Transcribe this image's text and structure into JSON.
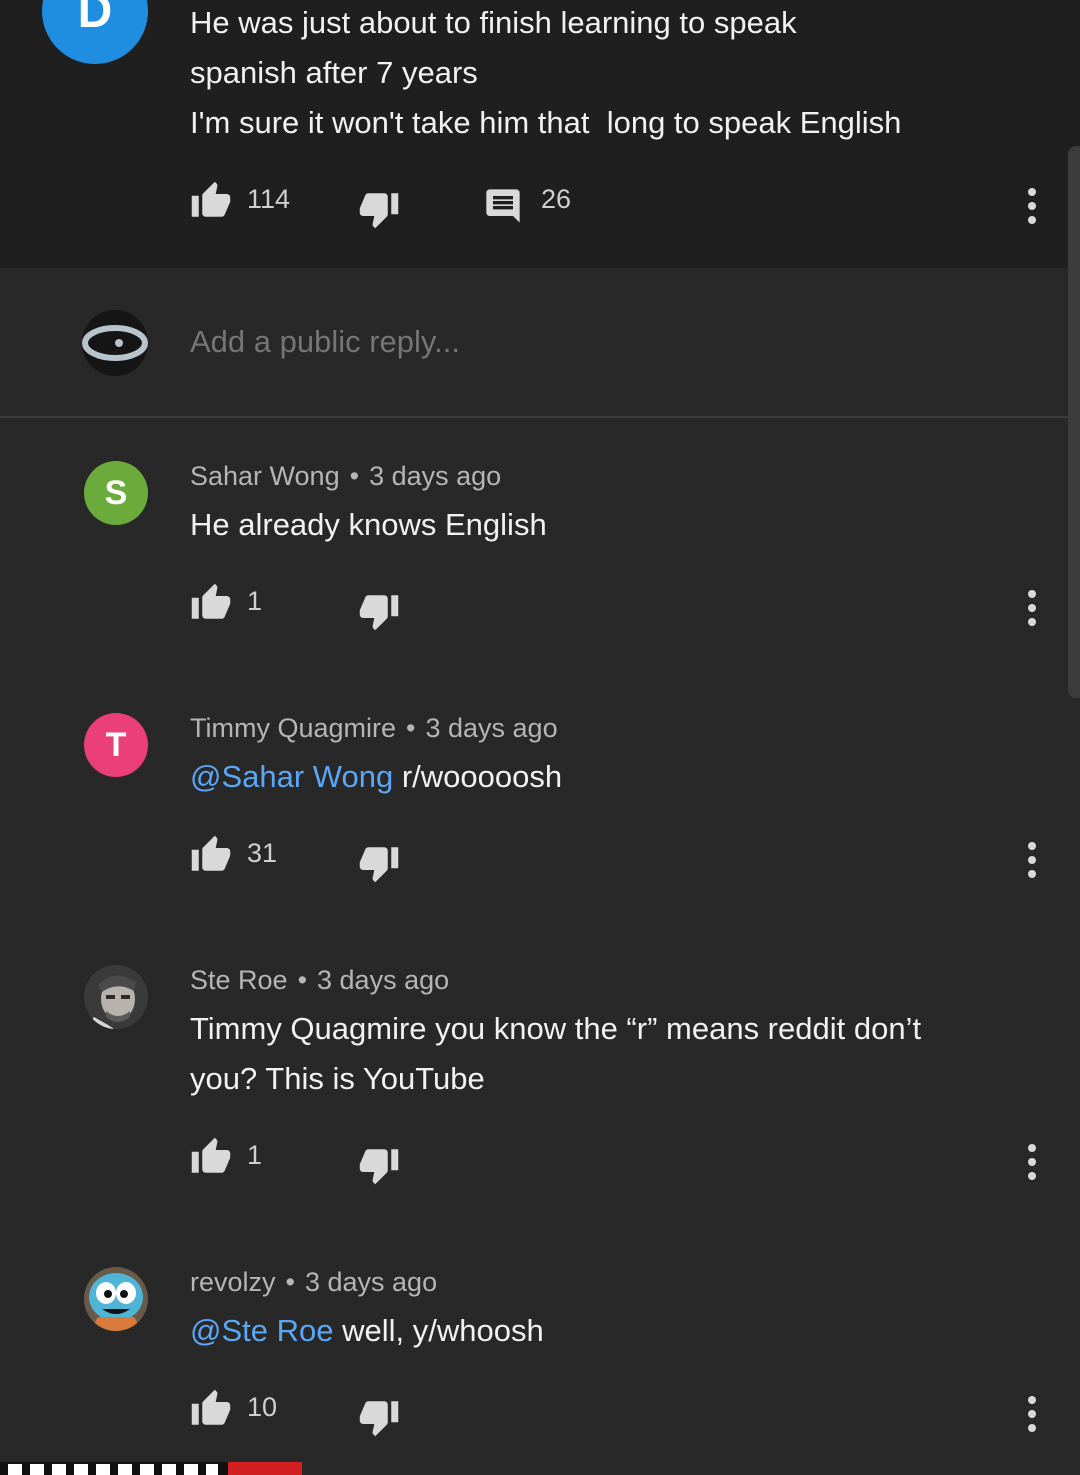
{
  "top_comment": {
    "avatar_letter": "D",
    "avatar_color": "#1f8ee0",
    "lines": [
      "He was just about to finish learning to speak",
      "spanish after 7 years",
      "I'm sure it won't take him that  long to speak English"
    ],
    "likes": "114",
    "replies_count": "26"
  },
  "reply_box": {
    "placeholder": "Add a public reply..."
  },
  "replies": [
    {
      "author": "Sahar Wong",
      "time": "3 days ago",
      "avatar_letter": "S",
      "avatar_color": "#6aab3b",
      "mention": "",
      "lines": [
        "He already knows English"
      ],
      "likes": "1"
    },
    {
      "author": "Timmy Quagmire",
      "time": "3 days ago",
      "avatar_letter": "T",
      "avatar_color": "#ea3f79",
      "mention": "@Sahar Wong",
      "lines": [
        " r/wooooosh"
      ],
      "likes": "31"
    },
    {
      "author": "Ste Roe",
      "time": "3 days ago",
      "avatar_letter": "",
      "avatar_color": "#8a8a8a",
      "mention": "",
      "lines": [
        "Timmy Quagmire you know the “r” means reddit don’t",
        "you? This is YouTube"
      ],
      "likes": "1"
    },
    {
      "author": "revolzy",
      "time": "3 days ago",
      "avatar_letter": "",
      "avatar_color": "#4fb5d6",
      "mention": "@Ste Roe",
      "lines": [
        " well, y/whoosh"
      ],
      "likes": "10"
    }
  ],
  "separator": "•",
  "icons": {
    "like": "thumbs-up-icon",
    "dislike": "thumbs-down-icon",
    "reply": "comment-icon",
    "more": "more-vertical-icon"
  },
  "colors": {
    "mention": "#5aa7f5",
    "top_comment_bg": "#1f1f1f",
    "page_bg": "#282828"
  }
}
